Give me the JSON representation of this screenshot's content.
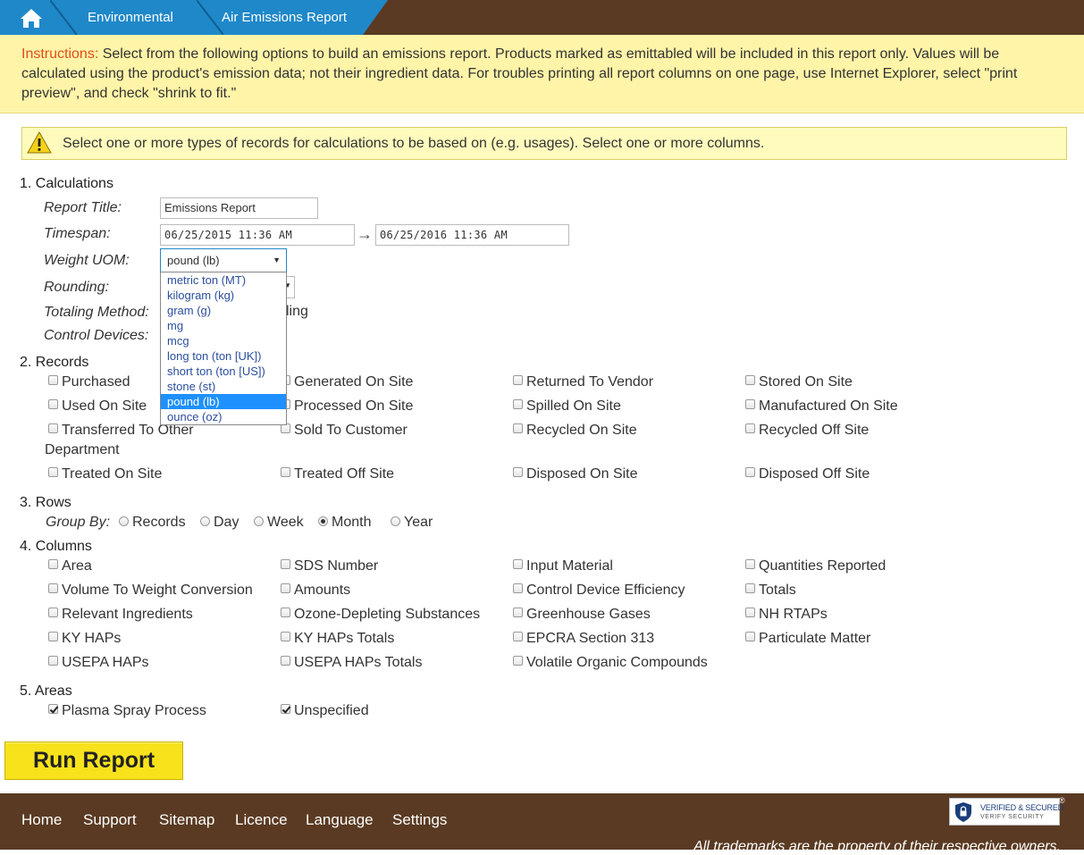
{
  "breadcrumb": {
    "home_icon": "home-icon",
    "items": [
      "Environmental",
      "Air Emissions Report"
    ]
  },
  "instructions": {
    "label": "Instructions:",
    "text": " Select from the following options to build an emissions report. Products marked as emittabled will be included in this report only. Values will be calculated using the product's emission data; not their ingredient data. For troubles printing all report columns on one page, use Internet Explorer, select \"print preview\", and check \"shrink to fit.\""
  },
  "warning": {
    "icon": "warning-icon",
    "text": "Select one or more types of records for calculations to be based on (e.g. usages). Select one or more columns."
  },
  "calculations": {
    "title": "1. Calculations",
    "report_title_label": "Report Title:",
    "report_title_value": "Emissions Report",
    "timespan_label": "Timespan:",
    "timespan_start": "06/25/2015 11:36 AM",
    "timespan_arrow": "→",
    "timespan_end": "06/25/2016 11:36 AM",
    "weight_uom_label": "Weight UOM:",
    "weight_uom_value": "pound (lb)",
    "weight_uom_options": [
      "metric ton (MT)",
      "kilogram (kg)",
      "gram (g)",
      "mg",
      "mcg",
      "long ton (ton [UK])",
      "short ton (ton [US])",
      "stone (st)",
      "pound (lb)",
      "ounce (oz)"
    ],
    "rounding_label": "Rounding:",
    "totaling_label": "Totaling Method:",
    "totaling_partial": "ling",
    "control_devices_label": "Control Devices:"
  },
  "records": {
    "title": "2. Records",
    "items": [
      "Purchased",
      "Generated On Site",
      "Returned To Vendor",
      "Stored On Site",
      "Used On Site",
      "Processed On Site",
      "Spilled On Site",
      "Manufactured On Site",
      "Transferred To Other",
      "Sold To Customer",
      "Recycled On Site",
      "Recycled Off Site",
      "Treated On Site",
      "Treated Off Site",
      "Disposed On Site",
      "Disposed Off Site"
    ],
    "wrap_text": "Department"
  },
  "rows": {
    "title": "3. Rows",
    "group_by_label": "Group By:",
    "options": [
      "Records",
      "Day",
      "Week",
      "Month",
      "Year"
    ],
    "selected": "Month"
  },
  "columns": {
    "title": "4. Columns",
    "items": [
      "Area",
      "SDS Number",
      "Input Material",
      "Quantities Reported",
      "Volume To Weight Conversion",
      "Amounts",
      "Control Device Efficiency",
      "Totals",
      "Relevant Ingredients",
      "Ozone-Depleting Substances",
      "Greenhouse Gases",
      "NH RTAPs",
      "KY HAPs",
      "KY HAPs Totals",
      "EPCRA Section 313",
      "Particulate Matter",
      "USEPA HAPs",
      "USEPA HAPs Totals",
      "Volatile Organic Compounds"
    ]
  },
  "areas": {
    "title": "5. Areas",
    "items": [
      "Plasma Spray Process",
      "Unspecified"
    ],
    "checked": [
      true,
      true
    ]
  },
  "run_button": "Run Report",
  "footer": {
    "nav": [
      "Home",
      "Support",
      "Sitemap",
      "Licence",
      "Language",
      "Settings"
    ],
    "trademark": "All trademarks are the property of their respective owners.",
    "seal_line1": "VERIFIED & SECURED",
    "seal_line2": "VERIFY SECURITY",
    "seal_mark": "®"
  },
  "colors": {
    "brand_brown": "#5a3a22",
    "breadcrumb_blue": "#1f88c9",
    "instructions_bg": "#fff4a8",
    "instructions_label": "#e04e1c",
    "run_button": "#f7e21c",
    "dropdown_selected": "#1e90ff"
  }
}
